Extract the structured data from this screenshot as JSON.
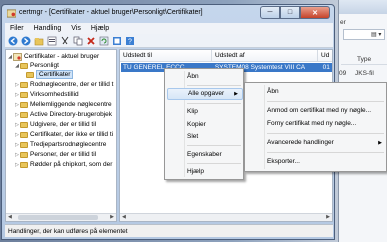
{
  "window": {
    "title": "certmgr - [Certifikater - aktuel bruger\\Personligt\\Certifikater]",
    "minimize": "─",
    "maximize": "□",
    "close": "✕"
  },
  "menubar": [
    "Filer",
    "Handling",
    "Vis",
    "Hjælp"
  ],
  "toolbar_icons": [
    "back-icon",
    "forward-icon",
    "up-icon",
    "properties-icon",
    "cut-icon",
    "copy-icon",
    "delete-icon",
    "refresh-icon",
    "export-icon",
    "help-icon"
  ],
  "tree": {
    "root": "Certifikater - aktuel bruger",
    "items": [
      {
        "label": "Personligt",
        "level": 1,
        "expanded": true
      },
      {
        "label": "Certifikater",
        "level": 2,
        "selected": true
      },
      {
        "label": "Rodnøglecentre, der er tillid t",
        "level": 1
      },
      {
        "label": "Virksomhedstillid",
        "level": 1
      },
      {
        "label": "Mellemliggende nøglecentre",
        "level": 1
      },
      {
        "label": "Active Directory-brugerobjek",
        "level": 1
      },
      {
        "label": "Udgivere, der er tillid til",
        "level": 1
      },
      {
        "label": "Certifikater, der ikke er tillid ti",
        "level": 1
      },
      {
        "label": "Tredjepartsrodnøglecentre",
        "level": 1
      },
      {
        "label": "Personer, der er tillid til",
        "level": 1
      },
      {
        "label": "Rødder på chipkort, som der",
        "level": 1
      }
    ]
  },
  "list": {
    "columns": [
      "Udstedt til",
      "Udstedt af",
      "Ud"
    ],
    "selected_row": {
      "issued_to": "TU GENEREL ECCC",
      "issued_by": "SYSTEM08 Systemtest VIII CA",
      "expires": "01"
    }
  },
  "context_menu": {
    "items": [
      "Åbn",
      "Alle opgaver",
      "Klip",
      "Kopier",
      "Slet",
      "Egenskaber",
      "Hjælp"
    ],
    "highlighted": "Alle opgaver"
  },
  "submenu": {
    "items": [
      "Åbn",
      "Anmod om certifikat med ny nøgle...",
      "Forny certifikat med ny nøgle...",
      "Avancerede handlinger",
      "Eksporter..."
    ]
  },
  "status": "Handlinger, der kan udføres på elementet",
  "bg_window": {
    "partial_text_1": "er",
    "type_header": "Type",
    "cell_1": "09",
    "cell_2": "JKS-fil"
  }
}
